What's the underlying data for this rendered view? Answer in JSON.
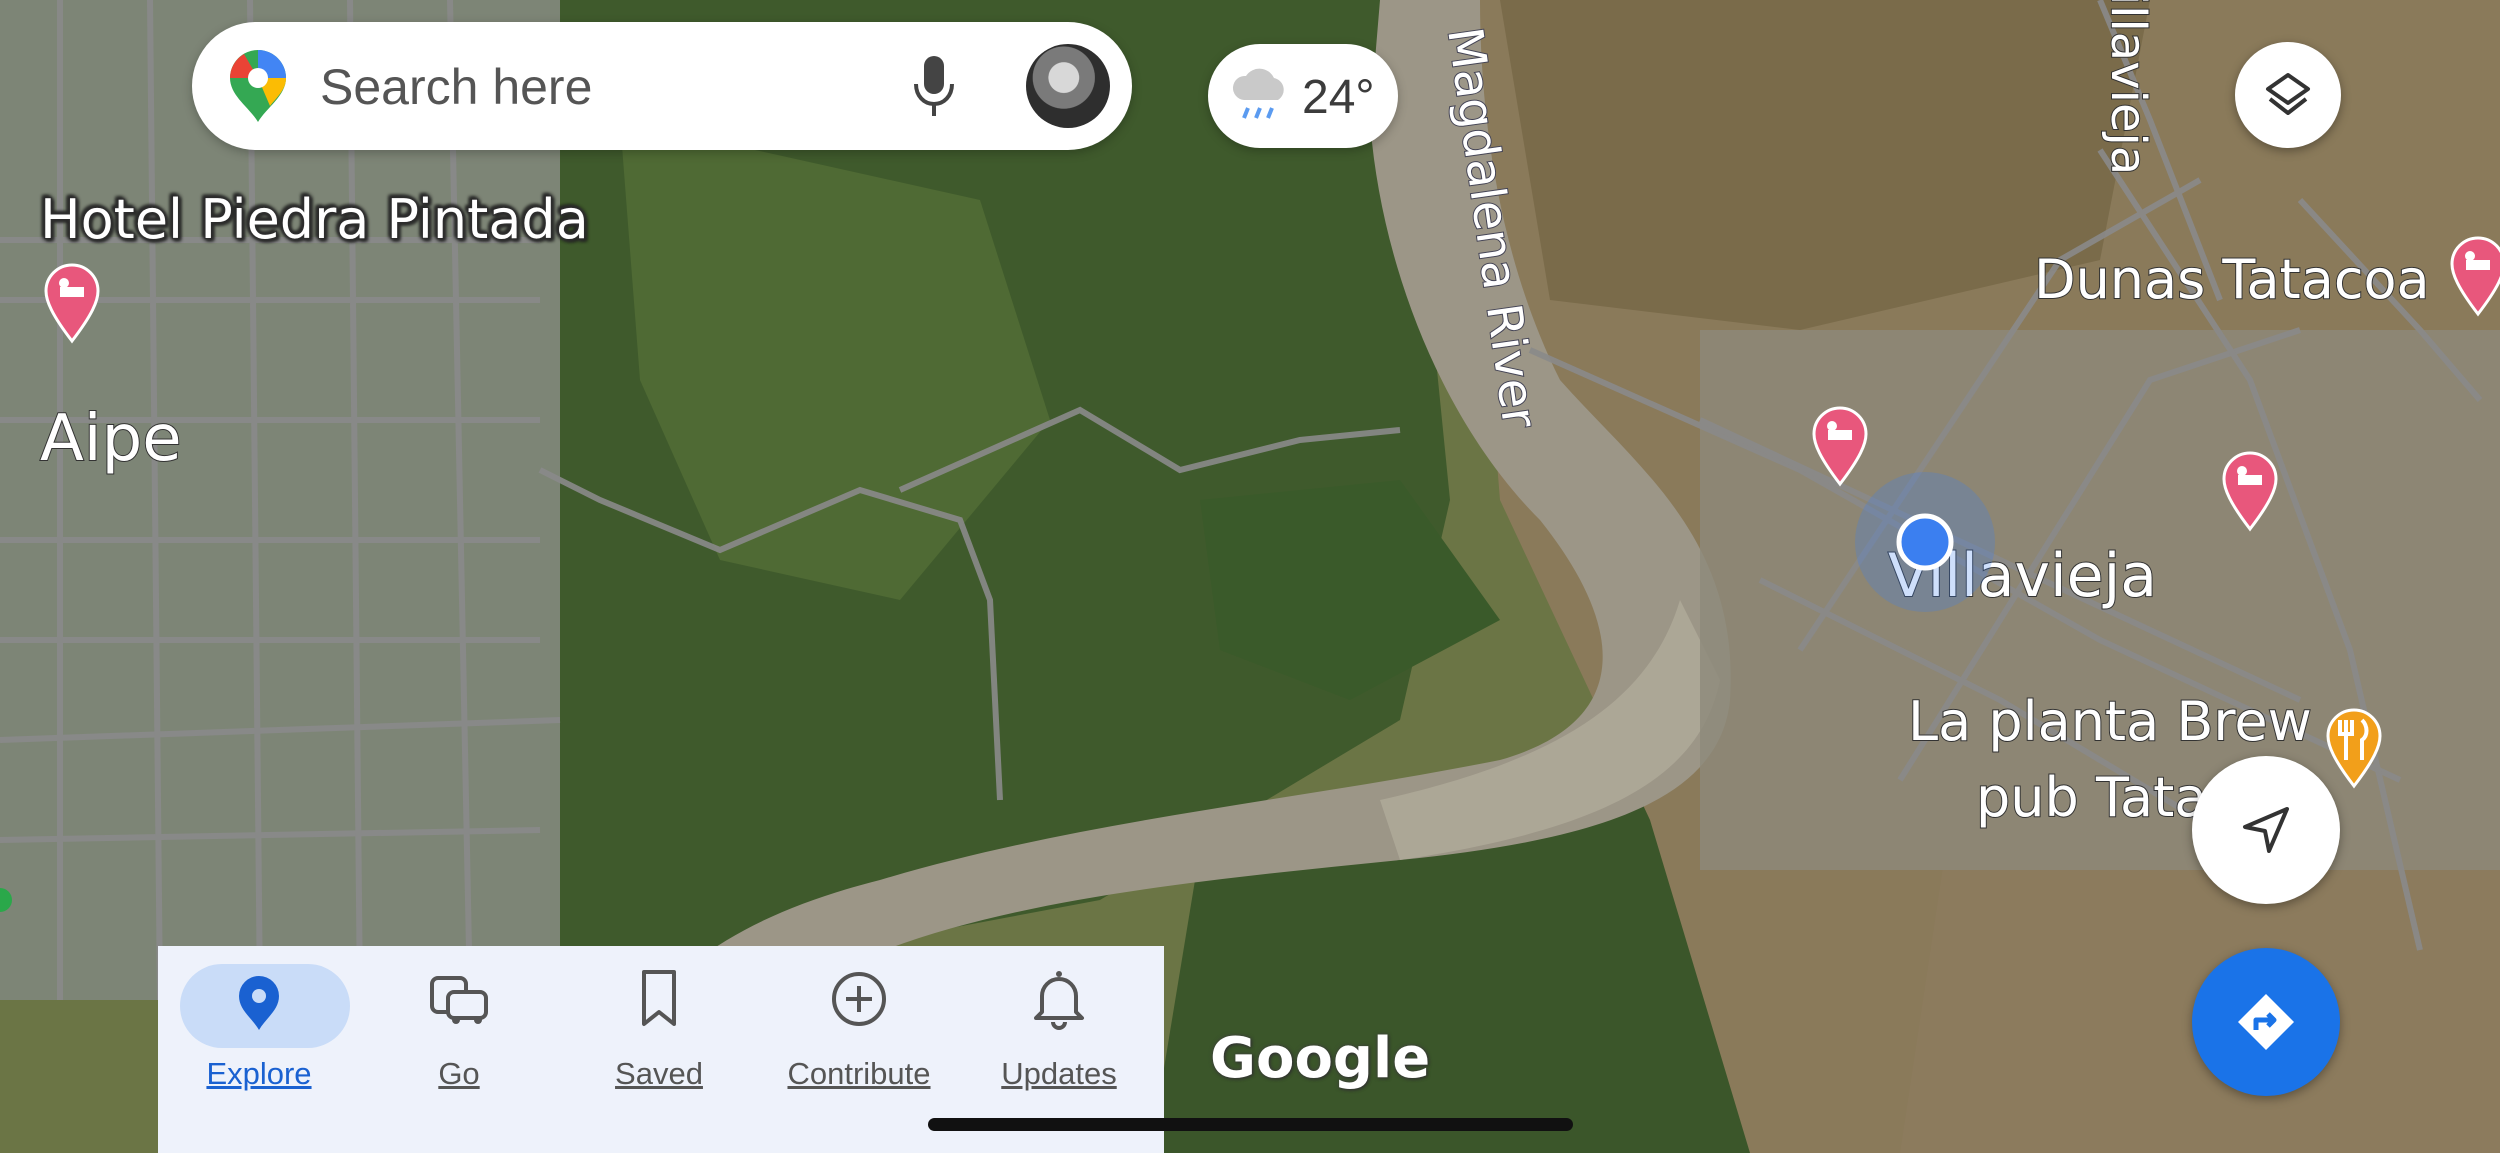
{
  "search": {
    "placeholder": "Search here"
  },
  "weather": {
    "temperature": "24°",
    "icon": "rain-cloud-icon"
  },
  "map": {
    "labels": {
      "hotel_piedra_pintada": "Hotel Piedra Pintada",
      "aipe": "Aipe",
      "magdalena_river": "Magdalena River",
      "villavieja": "Villavieja",
      "villavieja_road": "Villavieja",
      "dunas_tatacoa": "Dunas Tatacoa",
      "la_planta_line1": "La planta Brew",
      "la_planta_line2": "pub Tata"
    },
    "attribution": "Google",
    "colors": {
      "hotel_pin": "#e8577c",
      "restaurant_pin": "#f29f1a",
      "location_dot": "#3b7ff0",
      "fab_blue": "#1a73e8"
    }
  },
  "nav": {
    "explore": "Explore",
    "go": "Go",
    "saved": "Saved",
    "contribute": "Contribute",
    "updates": "Updates"
  }
}
